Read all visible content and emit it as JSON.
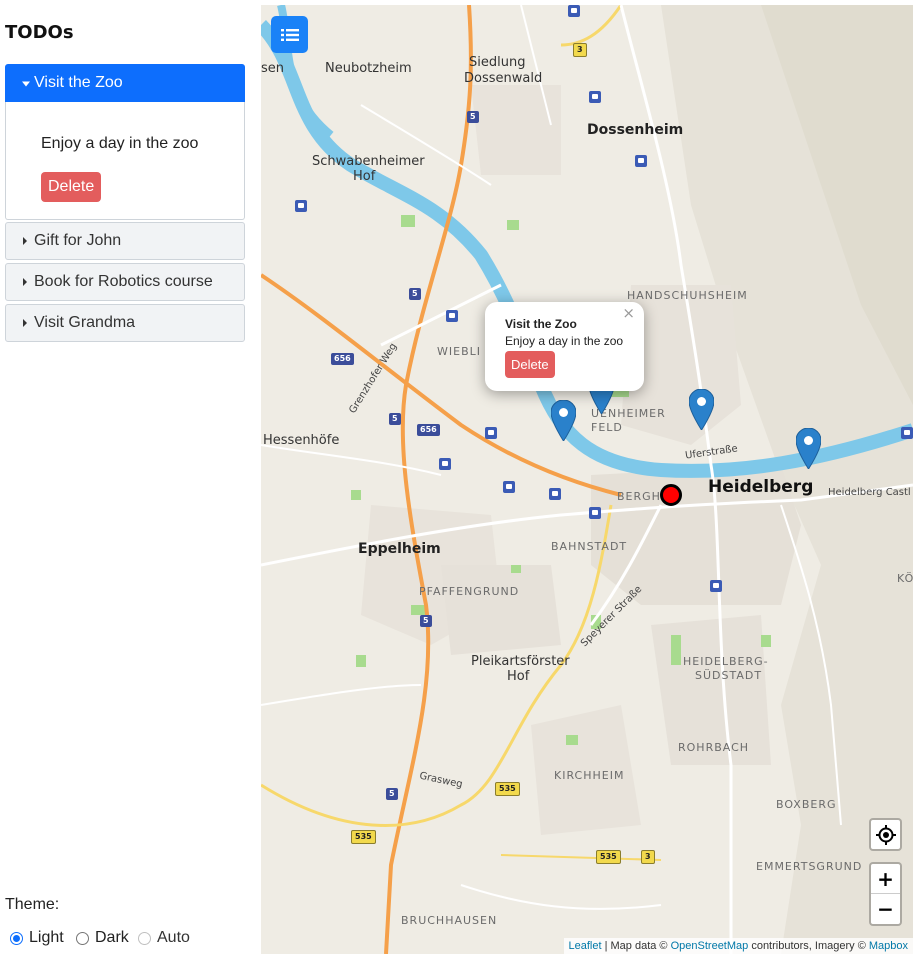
{
  "sidebar": {
    "title": "TODOs",
    "todos": [
      {
        "label": "Visit the Zoo",
        "description": "Enjoy a day in the zoo",
        "delete_label": "Delete",
        "expanded": true
      },
      {
        "label": "Gift for John",
        "expanded": false
      },
      {
        "label": "Book for Robotics course",
        "expanded": false
      },
      {
        "label": "Visit Grandma",
        "expanded": false
      }
    ],
    "theme": {
      "label": "Theme:",
      "options": [
        {
          "label": "Light",
          "selected": true
        },
        {
          "label": "Dark",
          "selected": false
        },
        {
          "label": "Auto",
          "selected": false,
          "disabled": true
        }
      ]
    }
  },
  "map": {
    "list_button_icon": "list-icon",
    "popup": {
      "title": "Visit the Zoo",
      "description": "Enjoy a day in the zoo",
      "delete_label": "Delete",
      "close": "×"
    },
    "places": {
      "neubotzheim": "Neubotzheim",
      "siedlung1": "Siedlung",
      "siedlung2": "Dossenwald",
      "dossenheim": "Dossenheim",
      "schwaben1": "Schwabenheimer",
      "schwaben2": "Hof",
      "handschuhsheim": "HANDSCHUHSHEIM",
      "wieblingen": "WIEBLI",
      "neuenheimer": "UENHEIMER",
      "feld": "FELD",
      "hessenhofe": "Hessenhöfe",
      "heidelberg": "Heidelberg",
      "heidelberg_castle": "Heidelberg Castl",
      "bergheim": "BERGH",
      "eppelheim": "Eppelheim",
      "bahnstadt": "BAHNSTADT",
      "pfaffengrund": "PFAFFENGRUND",
      "pleikarts1": "Pleikartsförster",
      "pleikarts2": "Hof",
      "suedstadt1": "HEIDELBERG-",
      "suedstadt2": "SÜDSTADT",
      "rohrbach": "ROHRBACH",
      "kirchheim": "KIRCHHEIM",
      "boxberg": "BOXBERG",
      "emmertsgrund": "EMMERTSGRUND",
      "bruchhausen": "BRUCHHAUSEN",
      "koenigstuhl": "KÖ",
      "sen": "sen"
    },
    "roads": {
      "uferstrasse": "Uferstraße",
      "grenzhofer": "Grenzhofer Weg",
      "speyerer": "Speyerer Straße",
      "grasweg": "Grasweg"
    },
    "shields": [
      "3",
      "5",
      "656",
      "535"
    ],
    "colors": {
      "river": "#7ec8e9",
      "motorway": "#f5a04a",
      "park": "#a8db8e",
      "marker": "#2a81cb",
      "list_button": "#1a82f7",
      "delete_button": "#e35d5d",
      "accordion_active": "#0d6efd",
      "location_dot": "#ff0000"
    },
    "zoom": {
      "in": "+",
      "out": "−"
    },
    "locate_icon": "crosshair-icon",
    "attribution": {
      "leaflet": "Leaflet",
      "sep": " | Map data © ",
      "osm": "OpenStreetMap",
      "mid": " contributors, Imagery © ",
      "mapbox": "Mapbox"
    }
  }
}
